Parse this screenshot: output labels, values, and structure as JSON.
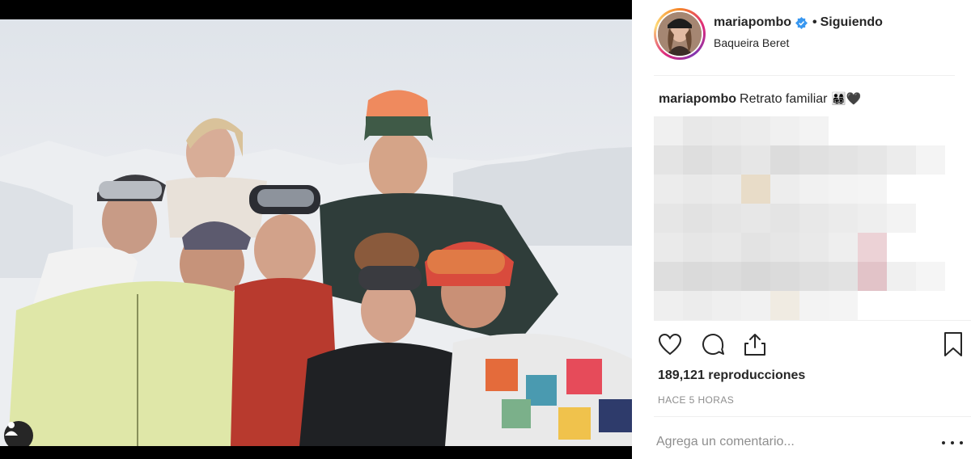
{
  "post": {
    "username": "mariapombo",
    "separator": "•",
    "follow_status": "Siguiendo",
    "location": "Baqueira Beret",
    "caption_user": "mariapombo",
    "caption_text": "Retrato familiar",
    "caption_emoji": "👨‍👩‍👧‍👦🖤",
    "views": "189,121 reproducciones",
    "time_ago": "HACE 5 HORAS",
    "comment_placeholder": "Agrega un comentario..."
  },
  "icons": {
    "verified": "verified-badge-icon",
    "like": "heart-icon",
    "comment": "comment-bubble-icon",
    "share": "share-icon",
    "save": "bookmark-icon",
    "user_tag": "user-tag-icon",
    "more": "more-options-icon"
  },
  "colors": {
    "verified": "#3897f0",
    "text": "#262626",
    "secondary": "#8e8e8e",
    "divider": "#efefef"
  }
}
